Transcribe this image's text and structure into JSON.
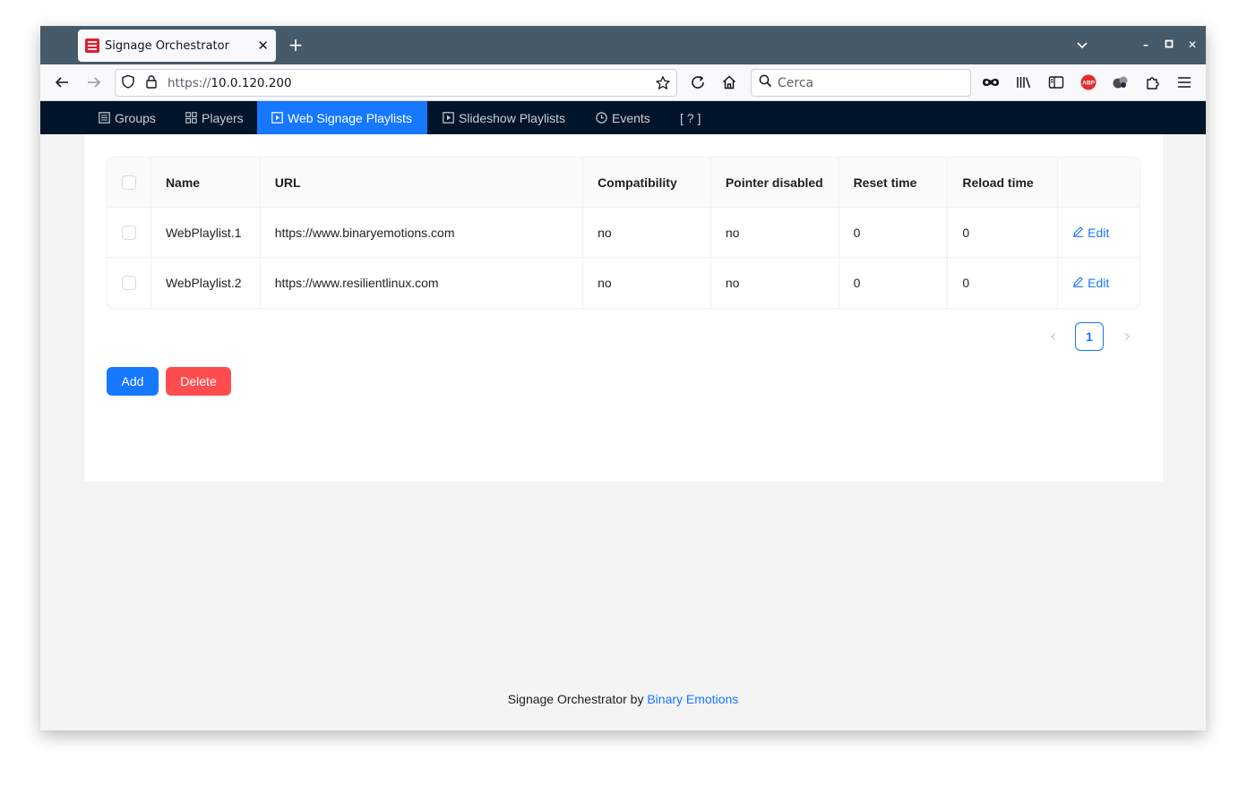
{
  "browser": {
    "tab_title": "Signage Orchestrator",
    "url_protocol": "https://",
    "url_host": "10.0.120.200",
    "search_placeholder": "Cerca",
    "icons": [
      "back-icon",
      "forward-icon",
      "shield-icon",
      "lock-icon",
      "star-icon",
      "reload-icon",
      "home-icon",
      "search-icon",
      "private-mask-icon",
      "library-icon",
      "sidebar-icon",
      "adblock-icon",
      "extension-icon",
      "puzzle-icon",
      "menu-icon"
    ]
  },
  "nav": {
    "items": [
      {
        "label": "Groups",
        "icon": "groups-icon"
      },
      {
        "label": "Players",
        "icon": "players-icon"
      },
      {
        "label": "Web Signage Playlists",
        "icon": "play-square-icon"
      },
      {
        "label": "Slideshow Playlists",
        "icon": "play-square-icon"
      },
      {
        "label": "Events",
        "icon": "clock-icon"
      },
      {
        "label": "[ ? ]",
        "icon": ""
      }
    ],
    "active_index": 2,
    "active_color": "#1677ff"
  },
  "table": {
    "columns": [
      "",
      "Name",
      "URL",
      "Compatibility",
      "Pointer disabled",
      "Reset time",
      "Reload time",
      ""
    ],
    "rows": [
      {
        "name": "WebPlaylist.1",
        "url": "https://www.binaryemotions.com",
        "compatibility": "no",
        "pointer_disabled": "no",
        "reset_time": "0",
        "reload_time": "0",
        "action": "Edit"
      },
      {
        "name": "WebPlaylist.2",
        "url": "https://www.resilientlinux.com",
        "compatibility": "no",
        "pointer_disabled": "no",
        "reset_time": "0",
        "reload_time": "0",
        "action": "Edit"
      }
    ]
  },
  "pagination": {
    "current_page": "1",
    "prev": "<",
    "next": ">"
  },
  "buttons": {
    "add": "Add",
    "delete": "Delete"
  },
  "footer": {
    "prefix": "Signage Orchestrator by ",
    "link": "Binary Emotions"
  },
  "colors": {
    "primary": "#1677ff",
    "danger": "#ff4d4f",
    "nav_bg": "#001529"
  }
}
